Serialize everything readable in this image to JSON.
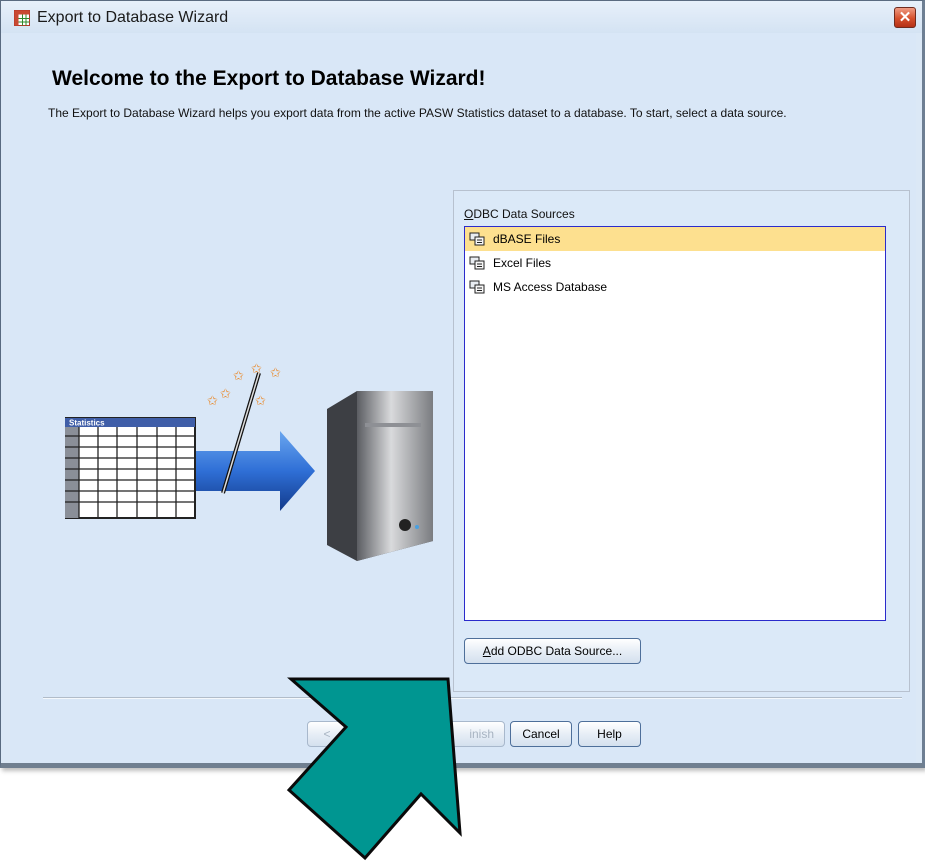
{
  "window": {
    "title": "Export to Database Wizard",
    "close_icon": "close-icon"
  },
  "page": {
    "heading": "Welcome to the Export to Database Wizard!",
    "intro": "The Export to Database Wizard helps you export data from the active PASW Statistics dataset to a database. To start, select a data source."
  },
  "illustration": {
    "table_label": "Statistics",
    "icons": [
      "spreadsheet-icon",
      "arrow-icon",
      "magic-wand-icon",
      "server-icon"
    ]
  },
  "odbc": {
    "label": "ODBC Data Sources",
    "items": [
      {
        "label": "dBASE Files",
        "selected": true
      },
      {
        "label": "Excel Files",
        "selected": false
      },
      {
        "label": "MS Access Database",
        "selected": false
      }
    ],
    "add_button": "Add ODBC Data Source..."
  },
  "footer": {
    "back_visible": "<",
    "finish_visible": "inish",
    "cancel": "Cancel",
    "help": "Help"
  },
  "colors": {
    "selection": "#fde08f",
    "overlay_arrow": "#009691"
  }
}
